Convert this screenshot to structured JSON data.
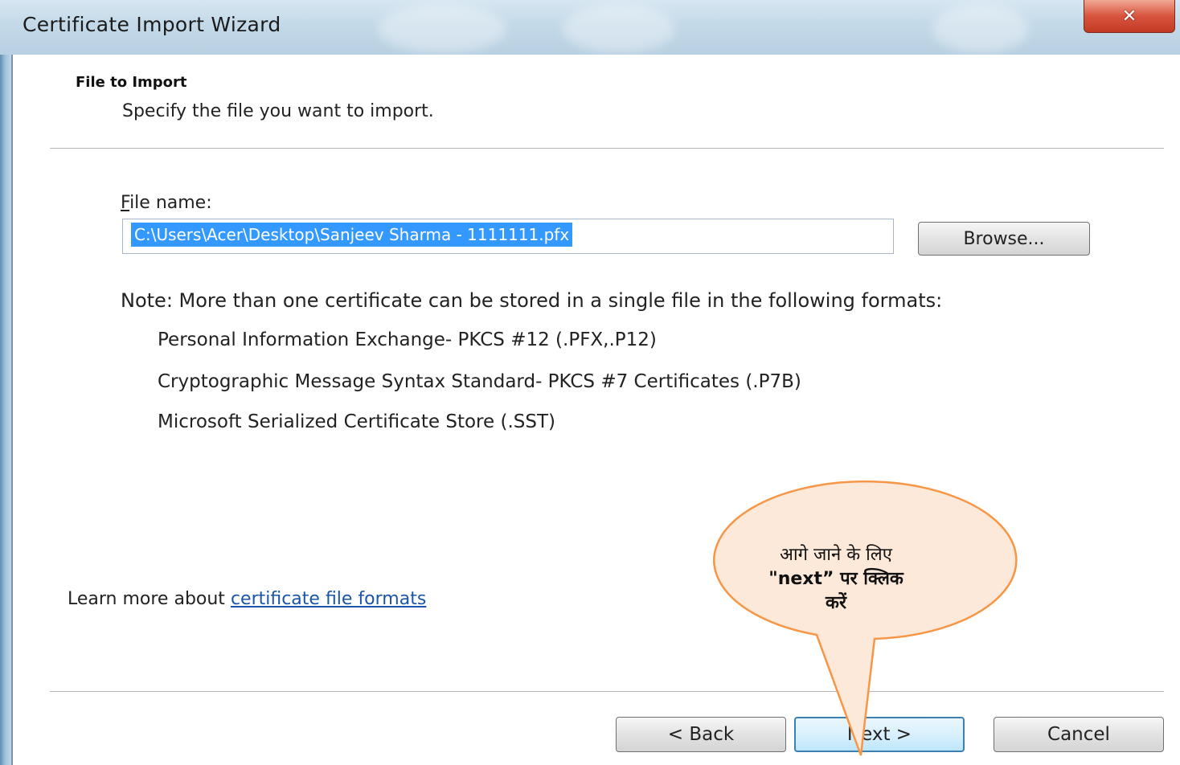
{
  "window": {
    "title": "Certificate Import Wizard",
    "close_glyph": "✕"
  },
  "header": {
    "title": "File to Import",
    "subtitle": "Specify the file you want to import."
  },
  "file": {
    "label_mnemonic": "F",
    "label_rest": "ile name:",
    "value": "C:\\Users\\Acer\\Desktop\\Sanjeev Sharma - 1111111.pfx",
    "browse_label": "Browse..."
  },
  "note": {
    "text": "Note:  More than one certificate can be stored in a single file in the following formats:",
    "formats": [
      "Personal Information Exchange- PKCS #12 (.PFX,.P12)",
      "Cryptographic Message Syntax Standard- PKCS #7 Certificates (.P7B)",
      "Microsoft Serialized Certificate Store (.SST)"
    ]
  },
  "learn_more": {
    "prefix": "Learn more about ",
    "link": "certificate file formats"
  },
  "buttons": {
    "back": "< Back",
    "next": "Next >",
    "cancel": "Cancel"
  },
  "callout": {
    "line1": "आगे जाने के लिए",
    "line2": "\"next” पर क्लिक",
    "line3": "करें",
    "fill_color": "#fde9d9",
    "border_color": "#f79646"
  }
}
